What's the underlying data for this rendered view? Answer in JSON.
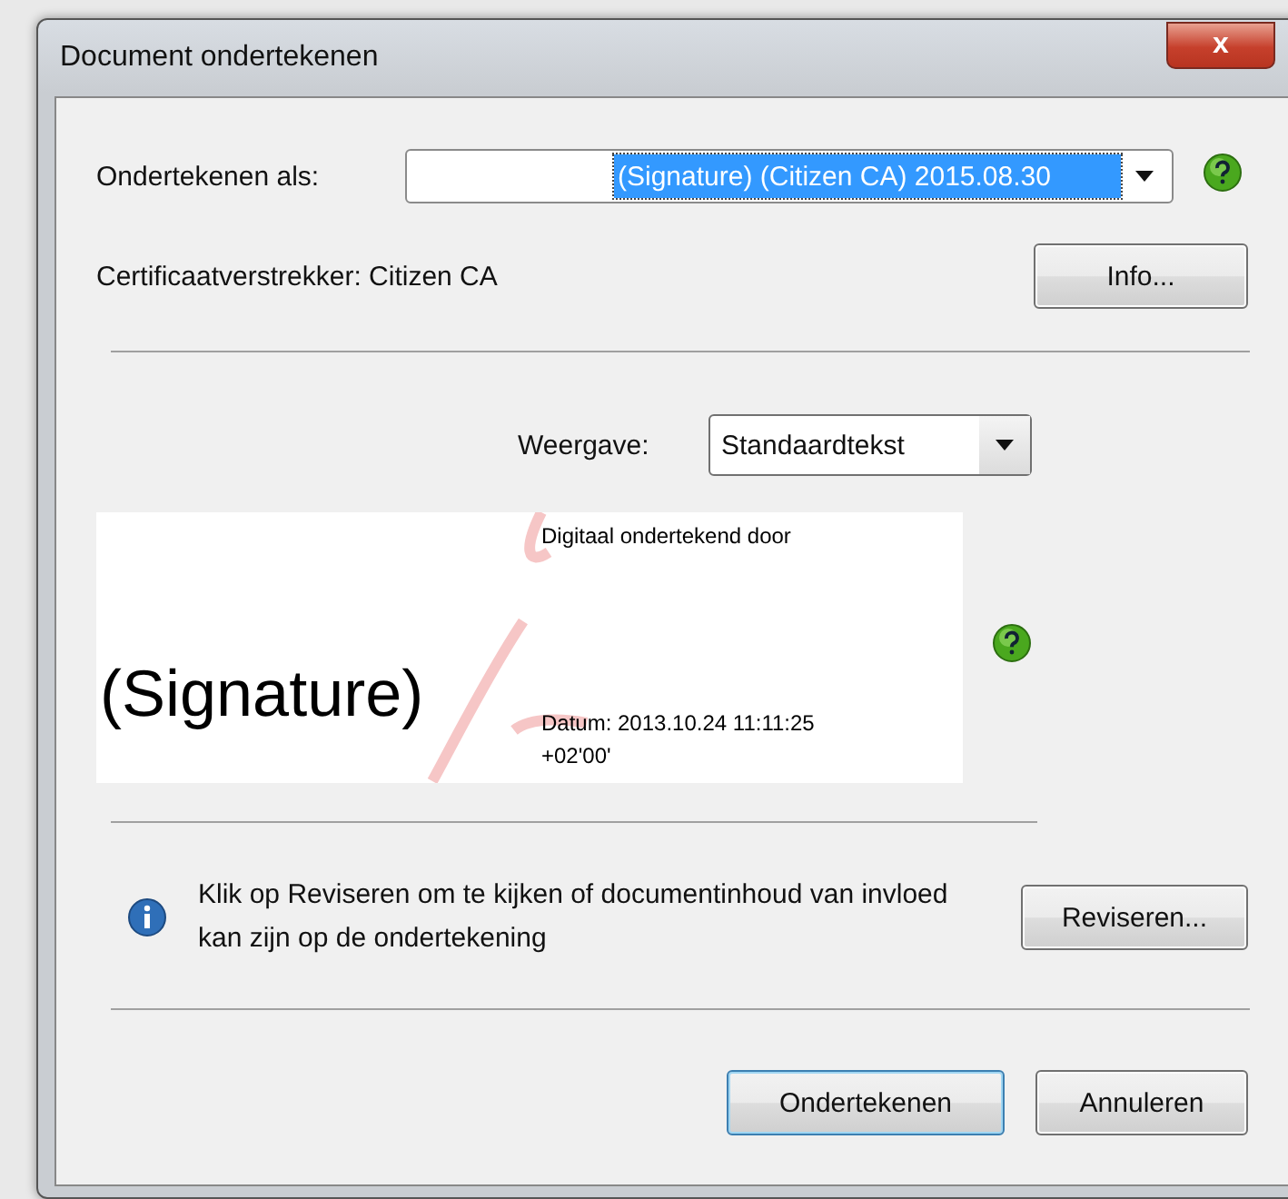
{
  "window": {
    "title": "Document ondertekenen",
    "close_label": "x"
  },
  "sign_as": {
    "label": "Ondertekenen als:",
    "value": "(Signature) (Citizen CA) 2015.08.30",
    "selected": true
  },
  "issuer": {
    "text": "Certificaatverstrekker: Citizen CA",
    "button": "Info..."
  },
  "appearance": {
    "label": "Weergave:",
    "value": "Standaardtekst"
  },
  "preview": {
    "name": "(Signature)",
    "line_1": "Digitaal ondertekend door",
    "line_2": "Datum: 2013.10.24 11:11:25",
    "line_3": "+02'00'"
  },
  "notice": {
    "text": "Klik op Reviseren om te kijken of documentinhoud van invloed kan zijn op de ondertekening",
    "button": "Reviseren..."
  },
  "buttons": [
    {
      "label": "Ondertekenen",
      "default": true
    },
    {
      "label": "Annuleren",
      "default": false
    }
  ]
}
